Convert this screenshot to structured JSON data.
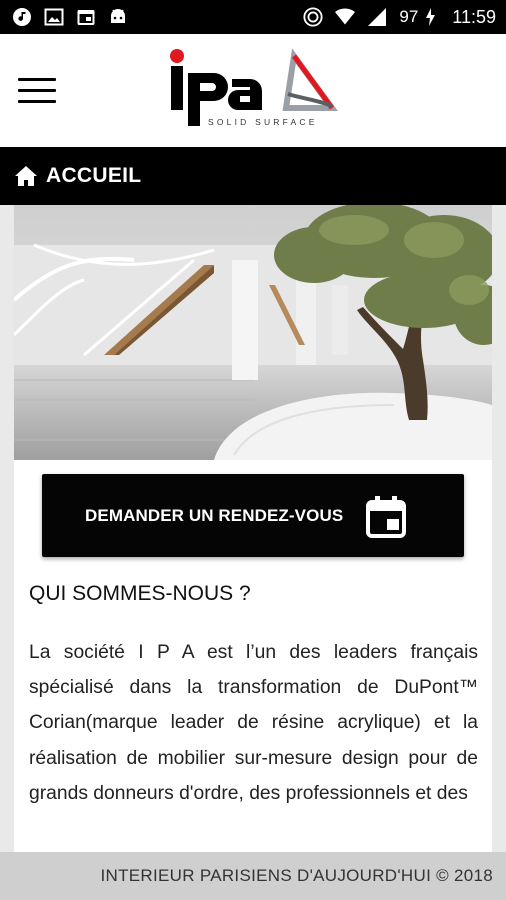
{
  "status_bar": {
    "left_icons": [
      "music-icon",
      "image-icon",
      "calendar-icon",
      "android-icon"
    ],
    "right_icons": [
      "cast-icon",
      "wifi-icon",
      "signal-icon",
      "battery-charging-icon"
    ],
    "battery": "97",
    "time": "11:59"
  },
  "header": {
    "logo_text": "ipa",
    "logo_subtitle": "SOLID SURFACE",
    "menu_icon": "hamburger-menu-icon"
  },
  "nav": {
    "title": "ACCUEIL",
    "icon": "home-icon"
  },
  "main": {
    "hero_image": "interior-atrium-with-olive-tree",
    "cta_label": "DEMANDER UN RENDEZ-VOUS",
    "cta_icon": "calendar-event-icon",
    "section_title": "QUI SOMMES-NOUS ?",
    "body": "La société I P A est l’un des leaders français spécialisé dans la transformation de DuPont™ Corian(marque leader de résine acrylique) et la réalisation de mobilier sur-mesure design pour de grands donneurs d'ordre, des professionnels et des"
  },
  "footer": {
    "text": "INTERIEUR PARISIENS D'AUJOURD'HUI © 2018"
  },
  "colors": {
    "accent_red": "#e0191f",
    "nav_black": "#000000",
    "footer_gray": "#cfcfcf",
    "page_gray": "#e9e9e9"
  }
}
